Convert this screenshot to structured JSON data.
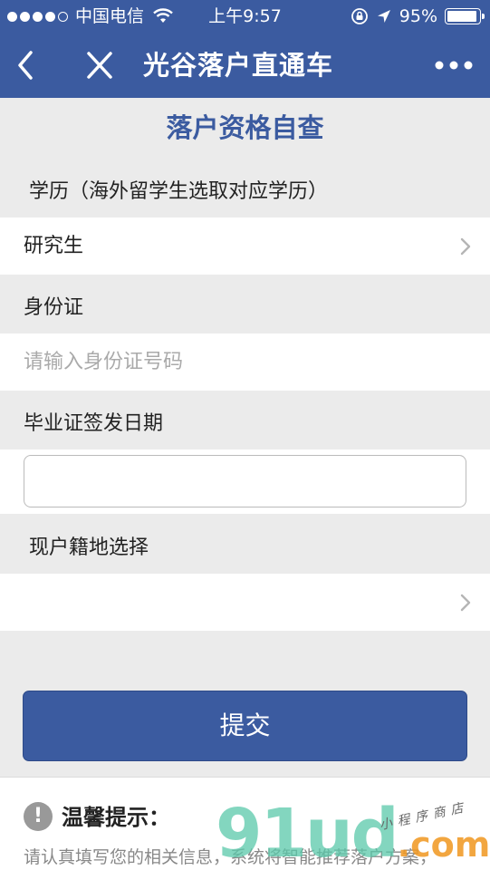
{
  "statusbar": {
    "carrier": "中国电信",
    "time": "上午9:57",
    "battery_percent": "95%",
    "battery_level": 0.95,
    "signal_bars": 4,
    "icons": [
      "wifi-icon",
      "orientation-lock-icon",
      "location-arrow-icon",
      "battery-icon"
    ]
  },
  "navbar": {
    "title": "光谷落户直通车",
    "icons": [
      "back-chevron-icon",
      "close-icon",
      "more-icon"
    ]
  },
  "form": {
    "title": "落户资格自查",
    "education": {
      "label": "学历（海外留学生选取对应学历）",
      "value": "研究生"
    },
    "id_card": {
      "label": "身份证",
      "placeholder": "请输入身份证号码",
      "value": ""
    },
    "graduation_date": {
      "label": "毕业证签发日期",
      "value": ""
    },
    "household": {
      "label": "现户籍地选择",
      "value": ""
    },
    "submit_label": "提交"
  },
  "tips": {
    "title": "温馨提示：",
    "icon": "exclamation-circle-icon",
    "text": "请认真填写您的相关信息，系统将智能推荐落户方案，"
  },
  "watermark": {
    "brand": "91ud",
    "suffix": ".com",
    "tagline": "小程序商店"
  },
  "colors": {
    "primary": "#3b5ba0",
    "background": "#ebebeb"
  }
}
